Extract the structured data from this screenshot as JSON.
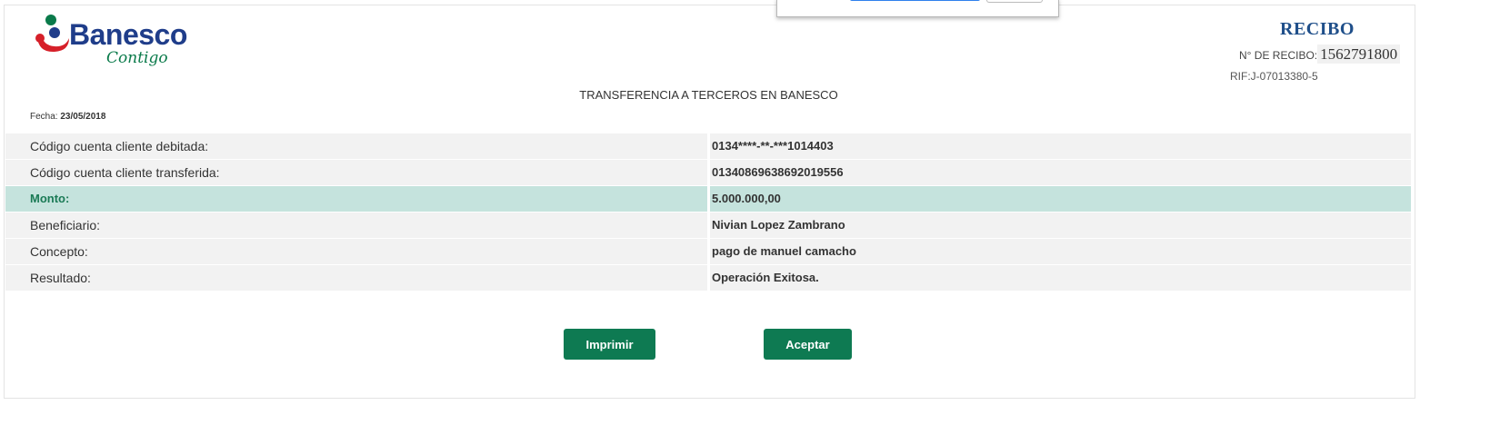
{
  "brand": {
    "name": "Banesco",
    "tagline": "Contigo",
    "colors": {
      "blue": "#1f3d8a",
      "red": "#d6202a",
      "green": "#0a7a4a"
    }
  },
  "receipt": {
    "title": "RECIBO",
    "number_label": "N° DE RECIBO:",
    "number": "1562791800",
    "rif": "RIF:J-07013380-5"
  },
  "operation": {
    "title": "TRANSFERENCIA A TERCEROS EN BANESCO",
    "date_label": "Fecha:",
    "date": "23/05/2018"
  },
  "details": [
    {
      "label": "Código cuenta cliente debitada:",
      "value": "0134****-**-***1014403",
      "highlight": false
    },
    {
      "label": "Código cuenta cliente transferida:",
      "value": "01340869638692019556",
      "highlight": false
    },
    {
      "label": "Monto:",
      "value": "5.000.000,00",
      "highlight": true
    },
    {
      "label": "Beneficiario:",
      "value": "Nivian Lopez Zambrano",
      "highlight": false
    },
    {
      "label": "Concepto:",
      "value": "pago de manuel camacho",
      "highlight": false
    },
    {
      "label": "Resultado:",
      "value": "Operación Exitosa.",
      "highlight": false
    }
  ],
  "actions": {
    "print_label": "Imprimir",
    "accept_label": "Aceptar",
    "button_color": "#0e7a52"
  }
}
